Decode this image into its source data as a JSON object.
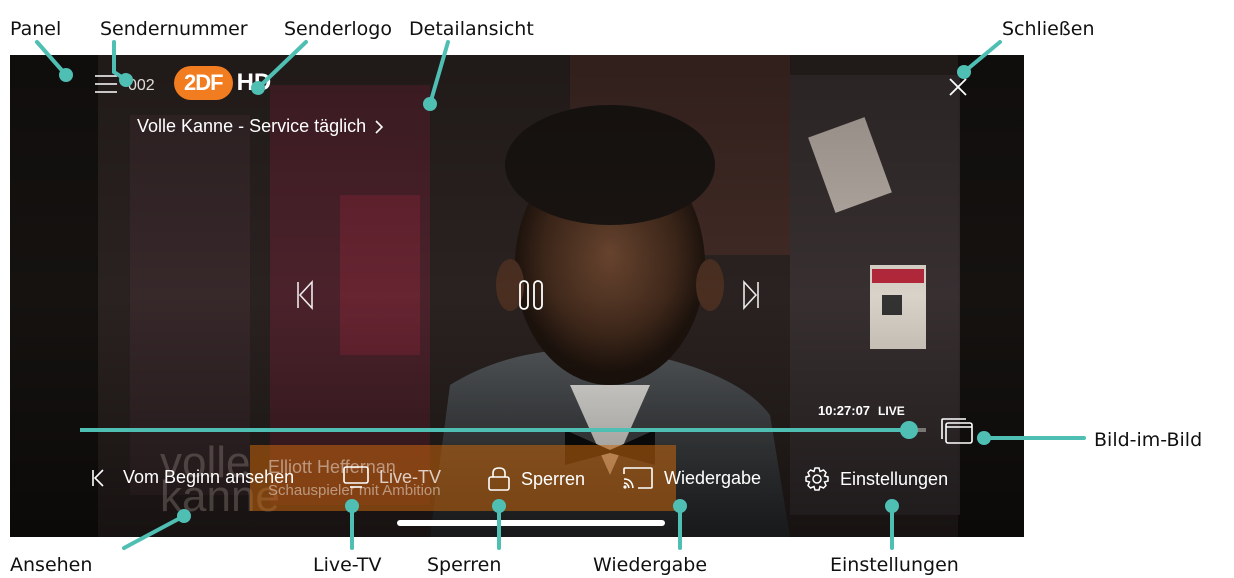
{
  "annotations": {
    "panel": "Panel",
    "sendernummer": "Sendernummer",
    "senderlogo": "Senderlogo",
    "detailansicht": "Detailansicht",
    "schliessen": "Schließen",
    "bild_im_bild": "Bild-im-Bild",
    "ansehen": "Ansehen",
    "live_tv": "Live-TV",
    "sperren": "Sperren",
    "wiedergabe": "Wiedergabe",
    "einstellungen": "Einstellungen"
  },
  "player": {
    "channel_number": "002",
    "channel_logo_text": "2DF",
    "channel_logo_hd": "HD",
    "program_title": "Volle Kanne - Service täglich",
    "time": "10:27:07",
    "live_badge": "LIVE",
    "progress": 0.98,
    "background_overlay": {
      "show_name_line1": "volle",
      "show_name_line2": "kanne",
      "lower_third_name": "Elliott Heffernan",
      "lower_third_caption": "Schauspieler mit Ambition"
    },
    "controls": {
      "vom_beginn": "Vom Beginn ansehen",
      "live_tv": "Live-TV",
      "sperren": "Sperren",
      "wiedergabe": "Wiedergabe",
      "einstellungen": "Einstellungen"
    },
    "colors": {
      "accent": "#4fbfb4",
      "logo_orange": "#f27d21",
      "annotation_line": "#4fbfb4"
    },
    "icons": [
      "menu-icon",
      "close-icon",
      "skip-back-icon",
      "pause-icon",
      "skip-forward-icon",
      "pip-icon",
      "start-over-icon",
      "tv-icon",
      "lock-icon",
      "cast-icon",
      "gear-icon"
    ]
  }
}
